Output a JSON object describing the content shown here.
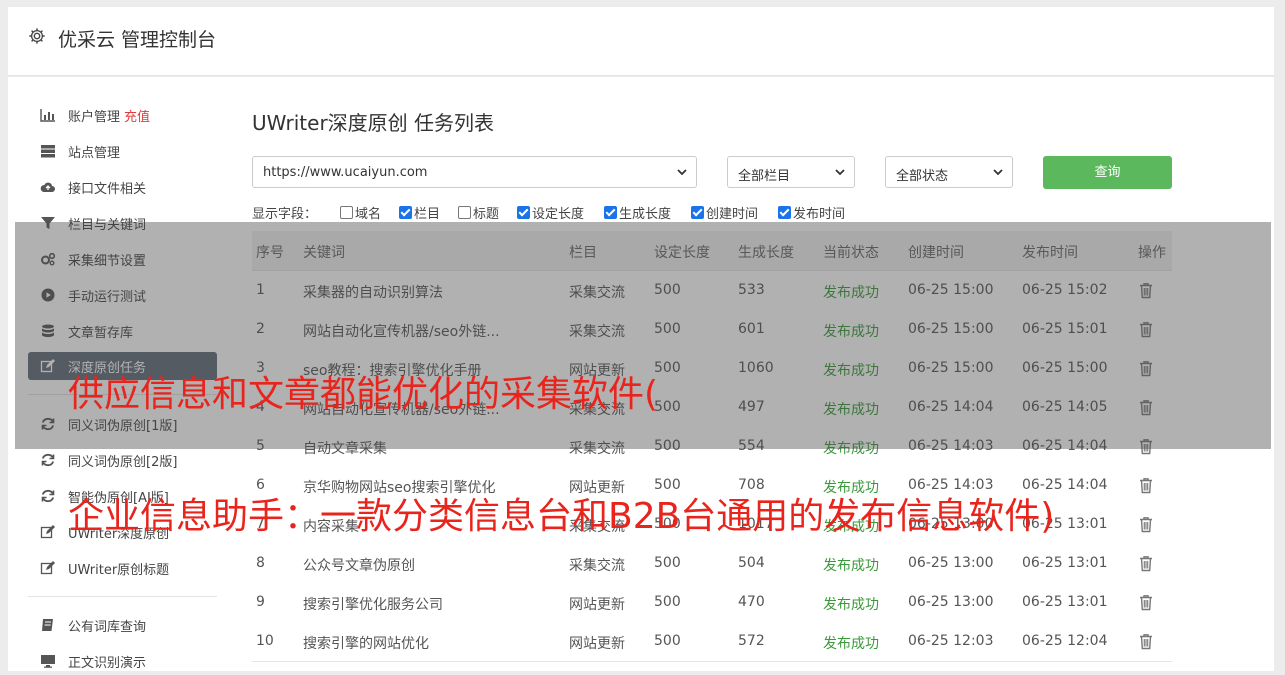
{
  "app": {
    "title": "优采云 管理控制台",
    "gear_icon": "gear-icon"
  },
  "sidebar": {
    "items": [
      {
        "label": "账户管理",
        "badge": "充值",
        "icon": "bar-chart-icon",
        "active": false
      },
      {
        "label": "站点管理",
        "icon": "server-icon",
        "active": false
      },
      {
        "label": "接口文件相关",
        "icon": "cloud-upload-icon",
        "active": false
      },
      {
        "label": "栏目与关键词",
        "icon": "filter-icon",
        "active": false
      },
      {
        "label": "采集细节设置",
        "icon": "gears-icon",
        "active": false
      },
      {
        "label": "手动运行测试",
        "icon": "play-circle-icon",
        "active": false
      },
      {
        "label": "文章暂存库",
        "icon": "database-icon",
        "active": false
      },
      {
        "label": "深度原创任务",
        "icon": "edit-icon",
        "active": true
      },
      {
        "label": "同义词伪原创[1版]",
        "icon": "refresh-icon",
        "active": false
      },
      {
        "label": "同义词伪原创[2版]",
        "icon": "refresh-icon",
        "active": false
      },
      {
        "label": "智能伪原创[AI版]",
        "icon": "refresh-icon",
        "active": false
      },
      {
        "label": "UWriter深度原创",
        "icon": "edit-icon",
        "active": false
      },
      {
        "label": "UWriter原创标题",
        "icon": "edit-icon",
        "active": false
      },
      {
        "label": "公有词库查询",
        "icon": "book-icon",
        "active": false
      },
      {
        "label": "正文识别演示",
        "icon": "monitor-icon",
        "active": false
      }
    ]
  },
  "main": {
    "title": "UWriter深度原创 任务列表",
    "site_select": "https://www.ucaiyun.com",
    "column_select": "全部栏目",
    "status_select": "全部状态",
    "query_button": "查询",
    "fields_label": "显示字段：",
    "fields": [
      {
        "label": "域名",
        "checked": false
      },
      {
        "label": "栏目",
        "checked": true
      },
      {
        "label": "标题",
        "checked": false
      },
      {
        "label": "设定长度",
        "checked": true
      },
      {
        "label": "生成长度",
        "checked": true
      },
      {
        "label": "创建时间",
        "checked": true
      },
      {
        "label": "发布时间",
        "checked": true
      }
    ]
  },
  "table": {
    "headers": [
      "序号",
      "关键词",
      "栏目",
      "设定长度",
      "生成长度",
      "当前状态",
      "创建时间",
      "发布时间",
      "操作"
    ],
    "rows": [
      [
        "1",
        "采集器的自动识别算法",
        "采集交流",
        "500",
        "533",
        "发布成功",
        "06-25 15:00",
        "06-25 15:02"
      ],
      [
        "2",
        "网站自动化宣传机器/seo外链...",
        "采集交流",
        "500",
        "601",
        "发布成功",
        "06-25 15:00",
        "06-25 15:01"
      ],
      [
        "3",
        "seo教程：搜索引擎优化手册",
        "网站更新",
        "500",
        "1060",
        "发布成功",
        "06-25 15:00",
        "06-25 15:00"
      ],
      [
        "4",
        "网站自动化宣传机器/seo外链...",
        "采集交流",
        "500",
        "497",
        "发布成功",
        "06-25 14:04",
        "06-25 14:05"
      ],
      [
        "5",
        "自动文章采集",
        "采集交流",
        "500",
        "554",
        "发布成功",
        "06-25 14:03",
        "06-25 14:04"
      ],
      [
        "6",
        "京华购物网站seo搜索引擎优化",
        "网站更新",
        "500",
        "708",
        "发布成功",
        "06-25 14:03",
        "06-25 14:04"
      ],
      [
        "7",
        "内容采集",
        "采集交流",
        "500",
        "1017",
        "发布成功",
        "06-25 13:00",
        "06-25 13:01"
      ],
      [
        "8",
        "公众号文章伪原创",
        "采集交流",
        "500",
        "504",
        "发布成功",
        "06-25 13:00",
        "06-25 13:01"
      ],
      [
        "9",
        "搜索引擎优化服务公司",
        "网站更新",
        "500",
        "470",
        "发布成功",
        "06-25 13:00",
        "06-25 13:01"
      ],
      [
        "10",
        "搜索引擎的网站优化",
        "网站更新",
        "500",
        "572",
        "发布成功",
        "06-25 12:03",
        "06-25 12:04"
      ]
    ]
  },
  "overlay": {
    "line1": "供应信息和文章都能优化的采集软件(",
    "line2": "企业信息助手：一款分类信息台和B2B台通用的发布信息软件)"
  },
  "colors": {
    "accent_green": "#5cb85c",
    "active_nav": "#5f6b78",
    "headline_red": "#e8241c",
    "status_green": "#3a9a3a"
  }
}
